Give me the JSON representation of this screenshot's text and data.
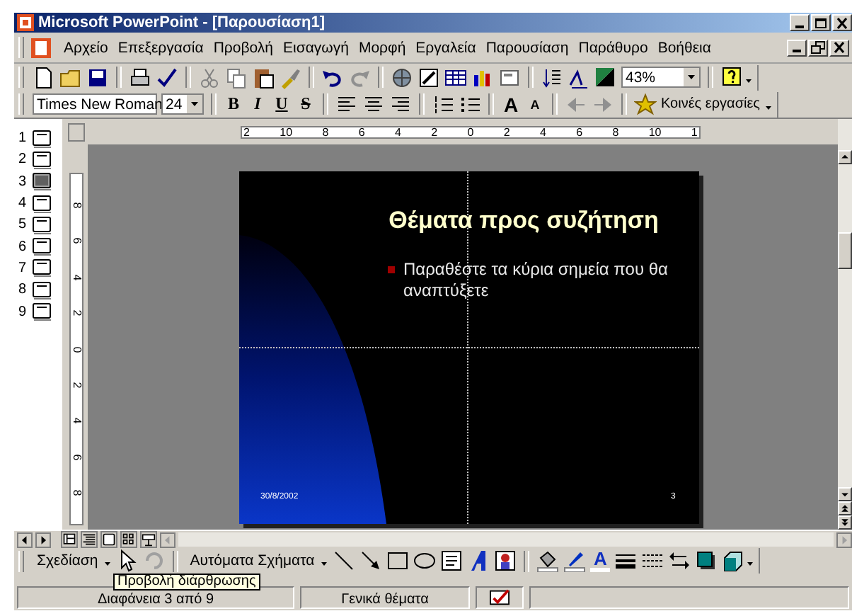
{
  "window": {
    "title": "Microsoft PowerPoint - [Παρουσίαση1]"
  },
  "menu": [
    "Αρχείο",
    "Επεξεργασία",
    "Προβολή",
    "Εισαγωγή",
    "Μορφή",
    "Εργαλεία",
    "Παρουσίαση",
    "Παράθυρο",
    "Βοήθεια"
  ],
  "standard_toolbar": {
    "zoom": "43%"
  },
  "formatting_toolbar": {
    "font": "Times New Roman",
    "size": "24",
    "style_buttons": [
      "B",
      "I",
      "U",
      "S"
    ],
    "grow_font": "A",
    "shrink_font": "A",
    "common_tasks": "Κοινές εργασίες"
  },
  "slides_pane": [
    {
      "number": "1",
      "selected": false
    },
    {
      "number": "2",
      "selected": false
    },
    {
      "number": "3",
      "selected": true
    },
    {
      "number": "4",
      "selected": false
    },
    {
      "number": "5",
      "selected": false
    },
    {
      "number": "6",
      "selected": false
    },
    {
      "number": "7",
      "selected": false
    },
    {
      "number": "8",
      "selected": false
    },
    {
      "number": "9",
      "selected": false
    }
  ],
  "rulers": {
    "horizontal": [
      "2",
      "10",
      "8",
      "6",
      "4",
      "2",
      "0",
      "2",
      "4",
      "6",
      "8",
      "10",
      "1"
    ],
    "vertical": [
      "8",
      "6",
      "4",
      "2",
      "0",
      "2",
      "4",
      "6",
      "8"
    ]
  },
  "slide": {
    "title": "Θέματα προς συζήτηση",
    "bullets": [
      "Παραθέστε τα κύρια σημεία που θα αναπτύξετε"
    ],
    "date": "30/8/2002",
    "number": "3"
  },
  "drawing_toolbar": {
    "draw": "Σχεδίαση",
    "autoshapes": "Αυτόματα Σχήματα",
    "font_color": "A"
  },
  "tooltip": "Προβολή διάρθρωσης",
  "status_bar": {
    "slide": "Διαφάνεια  3 από 9",
    "design": "Γενικά θέματα"
  }
}
